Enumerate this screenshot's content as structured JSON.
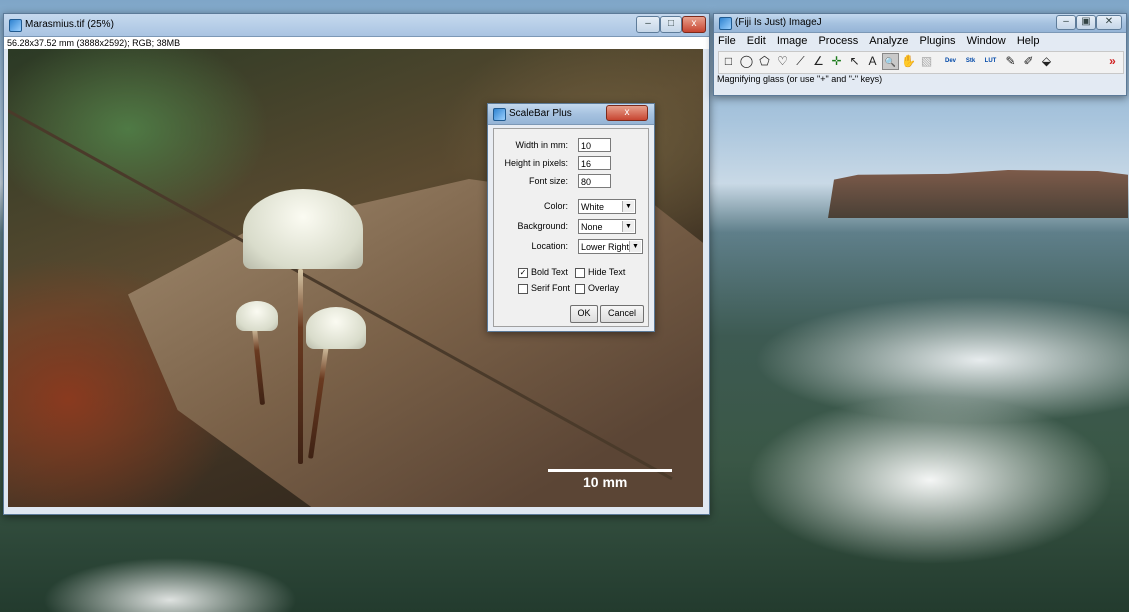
{
  "image_window": {
    "title": "Marasmius.tif (25%)",
    "info": "56.28x37.52 mm (3888x2592); RGB; 38MB",
    "controls": {
      "minimize": "–",
      "maximize": "□",
      "close": "x"
    },
    "scale_bar_label": "10 mm"
  },
  "dialog": {
    "title": "ScaleBar Plus",
    "close": "x",
    "fields": {
      "width_label": "Width in mm:",
      "width_value": "10",
      "height_label": "Height in pixels:",
      "height_value": "16",
      "font_label": "Font size:",
      "font_value": "80"
    },
    "selects": {
      "color_label": "Color:",
      "color_value": "White",
      "background_label": "Background:",
      "background_value": "None",
      "location_label": "Location:",
      "location_value": "Lower Right"
    },
    "checkboxes": {
      "bold_text": "Bold Text",
      "bold_checked": "✓",
      "hide_text": "Hide Text",
      "serif_font": "Serif Font",
      "overlay": "Overlay"
    },
    "buttons": {
      "ok": "OK",
      "cancel": "Cancel"
    }
  },
  "fiji": {
    "title": "(Fiji Is Just) ImageJ",
    "controls": {
      "minimize": "–",
      "restore": "▣",
      "close": "✕"
    },
    "menu": [
      "File",
      "Edit",
      "Image",
      "Process",
      "Analyze",
      "Plugins",
      "Window",
      "Help"
    ],
    "tools": {
      "rectangle": "□",
      "oval": "◯",
      "polygon": "⬠",
      "freehand": "♡",
      "line": "⟋",
      "angle": "∠",
      "point": "✛",
      "wand": "↖",
      "text": "A",
      "magnifier": "🔍",
      "hand": "✋",
      "color_picker": "▧",
      "dev": "Dev",
      "stk": "Stk",
      "lut": "LUT",
      "pencil": "✎",
      "brush": "✐",
      "flood": "⬙",
      "more": "»"
    },
    "status": "Magnifying glass (or use \"+\" and \"-\" keys)"
  },
  "colors": {
    "titlebar": "#a6c2e0",
    "close": "#c74531",
    "more": "#d02020"
  }
}
